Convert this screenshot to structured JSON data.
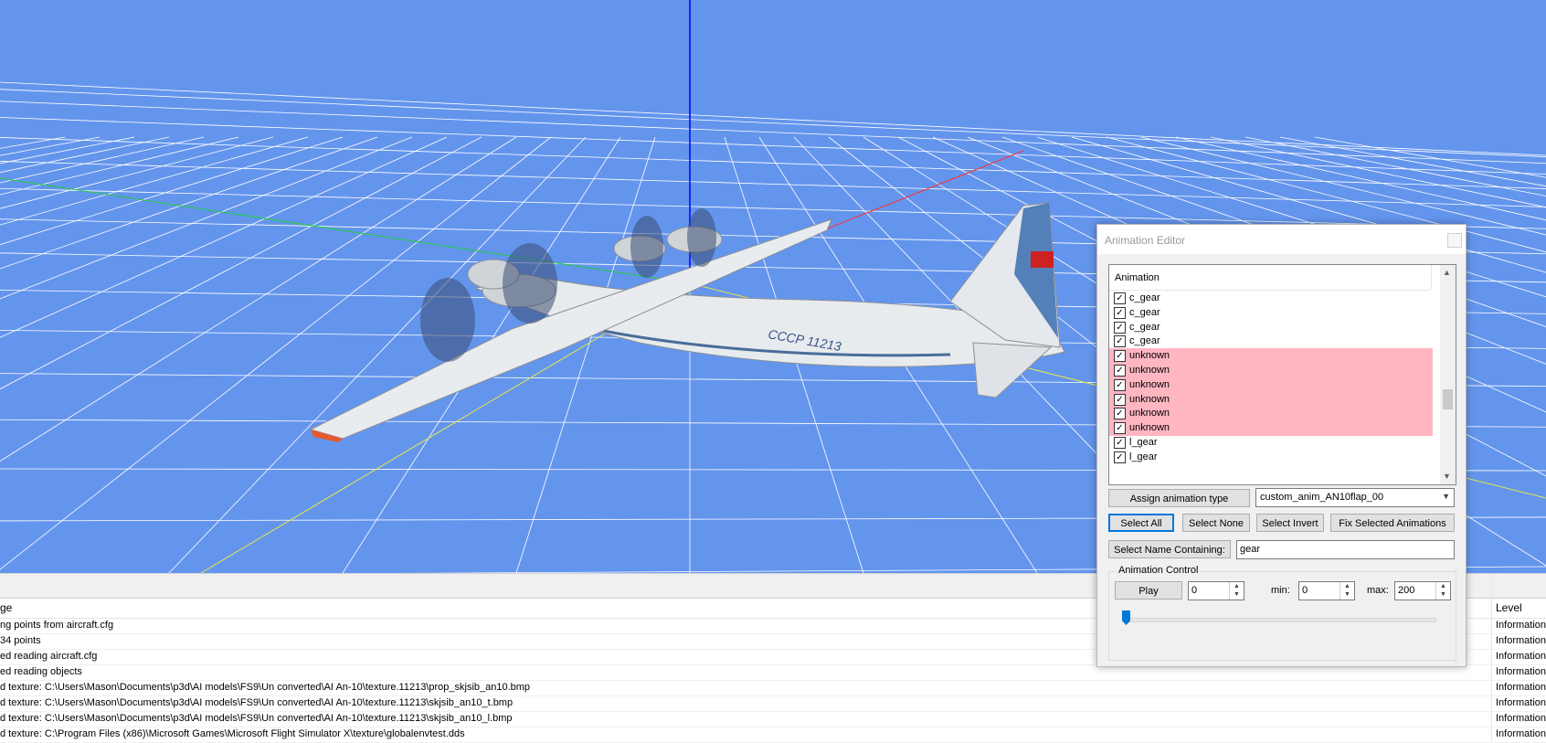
{
  "colors": {
    "viewport_bg": "#6495ED",
    "grid": "#ffffff",
    "axis_y": "#0000ff",
    "axis_x": "#ff0000",
    "axis_z": "#00ff00",
    "highlight_unknown": "#FFB6C1",
    "focus_border": "#0078d7"
  },
  "viewport": {
    "aircraft_registration": "CCCP 11213"
  },
  "log": {
    "col_message": "ge",
    "col_level": "Level",
    "rows": [
      {
        "message": "ng points from aircraft.cfg",
        "level": "Information"
      },
      {
        "message": "34 points",
        "level": "Information"
      },
      {
        "message": "ed reading aircraft.cfg",
        "level": "Information"
      },
      {
        "message": "ed reading objects",
        "level": "Information"
      },
      {
        "message": "d texture: C:\\Users\\Mason\\Documents\\p3d\\AI models\\FS9\\Un converted\\AI An-10\\texture.11213\\prop_skjsib_an10.bmp",
        "level": "Information"
      },
      {
        "message": "d texture: C:\\Users\\Mason\\Documents\\p3d\\AI models\\FS9\\Un converted\\AI An-10\\texture.11213\\skjsib_an10_t.bmp",
        "level": "Information"
      },
      {
        "message": "d texture: C:\\Users\\Mason\\Documents\\p3d\\AI models\\FS9\\Un converted\\AI An-10\\texture.11213\\skjsib_an10_l.bmp",
        "level": "Information"
      },
      {
        "message": "d texture: C:\\Program Files (x86)\\Microsoft Games\\Microsoft Flight Simulator X\\texture\\globalenvtest.dds",
        "level": "Information"
      }
    ]
  },
  "editor": {
    "title": "Animation Editor",
    "list_header": "Animation",
    "items": [
      {
        "name": "c_gear",
        "checked": true,
        "unknown": false
      },
      {
        "name": "c_gear",
        "checked": true,
        "unknown": false
      },
      {
        "name": "c_gear",
        "checked": true,
        "unknown": false
      },
      {
        "name": "c_gear",
        "checked": true,
        "unknown": false
      },
      {
        "name": "unknown",
        "checked": true,
        "unknown": true
      },
      {
        "name": "unknown",
        "checked": true,
        "unknown": true
      },
      {
        "name": "unknown",
        "checked": true,
        "unknown": true
      },
      {
        "name": "unknown",
        "checked": true,
        "unknown": true
      },
      {
        "name": "unknown",
        "checked": true,
        "unknown": true
      },
      {
        "name": "unknown",
        "checked": true,
        "unknown": true
      },
      {
        "name": "l_gear",
        "checked": true,
        "unknown": false
      },
      {
        "name": "l_gear",
        "checked": true,
        "unknown": false
      }
    ],
    "assign_label": "Assign animation type",
    "anim_type_value": "custom_anim_AN10flap_00",
    "select_all": "Select All",
    "select_none": "Select None",
    "select_invert": "Select Invert",
    "fix_selected": "Fix Selected Animations",
    "select_name_containing": "Select Name Containing:",
    "name_filter_value": "gear",
    "control_group": "Animation Control",
    "play_label": "Play",
    "frame_value": "0",
    "min_label": "min:",
    "min_value": "0",
    "max_label": "max:",
    "max_value": "200",
    "slider_position": 0
  }
}
